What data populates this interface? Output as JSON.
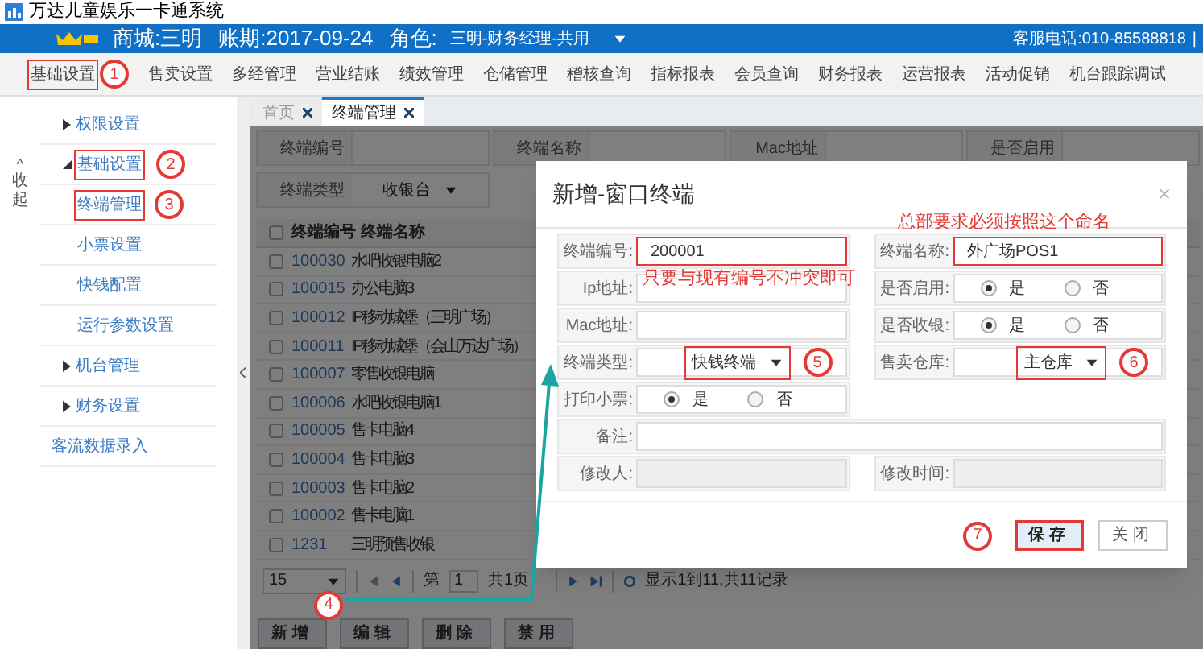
{
  "window": {
    "title": "万达儿童娱乐一卡通系统"
  },
  "header": {
    "mall": "商城:三明",
    "period": "账期:2017-09-24",
    "role_label": "角色:",
    "role": "三明-财务经理-共用",
    "hotline": "客服电话:010-85588818",
    "separator": "|"
  },
  "nav": [
    {
      "label": "基础设置",
      "highlighted": true,
      "marker": "1"
    },
    {
      "label": "售卖设置"
    },
    {
      "label": "多经管理"
    },
    {
      "label": "营业结账"
    },
    {
      "label": "绩效管理"
    },
    {
      "label": "仓储管理"
    },
    {
      "label": "稽核查询"
    },
    {
      "label": "指标报表"
    },
    {
      "label": "会员查询"
    },
    {
      "label": "财务报表"
    },
    {
      "label": "运营报表"
    },
    {
      "label": "活动促销"
    },
    {
      "label": "机台跟踪调试"
    }
  ],
  "sidebar": {
    "collapse_arrow": "^",
    "collapse": "收起",
    "items": [
      {
        "kind": "group",
        "label": "权限设置",
        "expanded": false
      },
      {
        "kind": "group",
        "label": "基础设置",
        "expanded": true,
        "highlighted": true,
        "marker": "2",
        "children": [
          {
            "label": "终端管理",
            "highlighted": true,
            "marker": "3"
          },
          {
            "label": "小票设置"
          },
          {
            "label": "快钱配置"
          },
          {
            "label": "运行参数设置"
          }
        ]
      },
      {
        "kind": "group",
        "label": "机台管理",
        "expanded": false
      },
      {
        "kind": "group",
        "label": "财务设置",
        "expanded": false
      },
      {
        "kind": "link",
        "label": "客流数据录入"
      }
    ]
  },
  "tabs": [
    {
      "label": "首页",
      "selected": false
    },
    {
      "label": "终端管理",
      "selected": true
    }
  ],
  "filters": [
    {
      "kind": "text",
      "label": "终端编号"
    },
    {
      "kind": "text",
      "label": "终端名称"
    },
    {
      "kind": "text",
      "label": "Mac地址"
    },
    {
      "kind": "text",
      "label": "是否启用"
    },
    {
      "kind": "select",
      "label": "终端类型",
      "value": "收银台"
    }
  ],
  "table": {
    "all_checked": false,
    "columns": [
      "终端编号",
      "终端名称"
    ],
    "rows": [
      {
        "checked": false,
        "id": "100030",
        "name": "水吧收银电脑2"
      },
      {
        "checked": false,
        "id": "100015",
        "name": "办公电脑3"
      },
      {
        "checked": false,
        "id": "100012",
        "name": "IP移动城堡（三明广场）"
      },
      {
        "checked": false,
        "id": "100011",
        "name": "IP移动城堡（会山万达广场）"
      },
      {
        "checked": false,
        "id": "100007",
        "name": "零售收银电脑"
      },
      {
        "checked": false,
        "id": "100006",
        "name": "水吧收银电脑1"
      },
      {
        "checked": false,
        "id": "100005",
        "name": "售卡电脑4"
      },
      {
        "checked": false,
        "id": "100004",
        "name": "售卡电脑3"
      },
      {
        "checked": false,
        "id": "100003",
        "name": "售卡电脑2"
      },
      {
        "checked": false,
        "id": "100002",
        "name": "售卡电脑1"
      },
      {
        "checked": false,
        "id": "1231",
        "name": "三明预售收银"
      }
    ]
  },
  "pager": {
    "page_size": "15",
    "page_label": "第",
    "page": "1",
    "total_pages": "共1页",
    "summary": "显示1到11,共11记录"
  },
  "actions": [
    {
      "label": "新增",
      "marker": "4"
    },
    {
      "label": "编辑"
    },
    {
      "label": "删除"
    },
    {
      "label": "禁用"
    }
  ],
  "dialog": {
    "title": "新增-窗口终端",
    "close": "×",
    "fields": [
      {
        "kind": "text",
        "label": "终端编号:",
        "value": "200001",
        "highlighted": true,
        "note": "只要与现有编号不冲突即可"
      },
      {
        "kind": "text",
        "label": "终端名称:",
        "value": "外广场POS1",
        "highlighted": true,
        "note": "总部要求必须按照这个命名"
      },
      {
        "kind": "text",
        "label": "Ip地址:"
      },
      {
        "kind": "radio",
        "label": "是否启用:",
        "options": [
          {
            "label": "是",
            "selected": true
          },
          {
            "label": "否",
            "selected": false
          }
        ]
      },
      {
        "kind": "text",
        "label": "Mac地址:"
      },
      {
        "kind": "radio",
        "label": "是否收银:",
        "options": [
          {
            "label": "是",
            "selected": true
          },
          {
            "label": "否",
            "selected": false
          }
        ]
      },
      {
        "kind": "select",
        "label": "终端类型:",
        "value": "快钱终端",
        "highlighted": true,
        "marker": "5"
      },
      {
        "kind": "select",
        "label": "售卖仓库:",
        "value": "主仓库",
        "highlighted": true,
        "marker": "6"
      },
      {
        "kind": "radio",
        "label": "打印小票:",
        "options": [
          {
            "label": "是",
            "selected": true
          },
          {
            "label": "否",
            "selected": false
          }
        ]
      },
      {
        "kind": "wide",
        "label": "备注:"
      },
      {
        "kind": "readonly",
        "label": "修改人:"
      },
      {
        "kind": "readonly",
        "label": "修改时间:"
      }
    ],
    "buttons": [
      {
        "label": "保存",
        "primary": true,
        "highlighted": true,
        "marker": "7"
      },
      {
        "label": "关闭",
        "primary": false
      }
    ]
  }
}
